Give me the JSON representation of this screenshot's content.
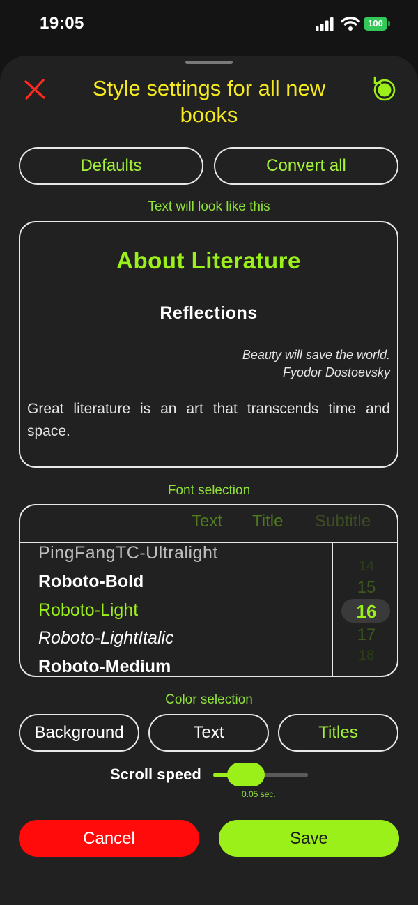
{
  "status_bar": {
    "time": "19:05",
    "battery": "100"
  },
  "header": {
    "title": "Style settings for all new books",
    "close_icon": "close-icon",
    "reset_icon": "reset-icon"
  },
  "actions": {
    "defaults": "Defaults",
    "convert_all": "Convert all"
  },
  "preview": {
    "label": "Text will look like this",
    "heading": "About Literature",
    "subheading": "Reflections",
    "quote": "Beauty will save the world.",
    "quote_author": "Fyodor Dostoevsky",
    "body": "Great literature is an art that transcends time and space."
  },
  "font_selection": {
    "label": "Font selection",
    "tabs": [
      "Text",
      "Title",
      "Subtitle"
    ],
    "fonts": [
      "PingFangTC-Ultralight",
      "Roboto-Bold",
      "Roboto-Light",
      "Roboto-LightItalic",
      "Roboto-Medium"
    ],
    "selected_font": "Roboto-Light",
    "sizes": [
      "14",
      "15",
      "16",
      "17",
      "18"
    ],
    "selected_size": "16"
  },
  "color_selection": {
    "label": "Color selection",
    "background": "Background",
    "text": "Text",
    "titles": "Titles"
  },
  "scroll_speed": {
    "label": "Scroll speed",
    "value": "0.05 sec.",
    "level": 0.1
  },
  "footer": {
    "cancel": "Cancel",
    "save": "Save"
  },
  "colors": {
    "accent": "#9cf01a",
    "title": "#f5ea1e",
    "cancel": "#ff0b0b",
    "sheet": "#212121"
  }
}
